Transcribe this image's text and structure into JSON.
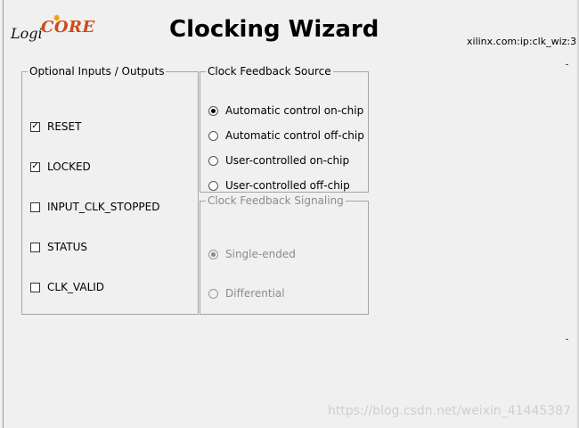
{
  "header": {
    "logo_logi": "Logi",
    "logo_core": "CORE",
    "title": "Clocking Wizard",
    "vlnv": "xilinx.com:ip:clk_wiz:3"
  },
  "optional_io": {
    "legend": "Optional Inputs / Outputs",
    "items": [
      {
        "label": "RESET",
        "checked": true
      },
      {
        "label": "LOCKED",
        "checked": true
      },
      {
        "label": "INPUT_CLK_STOPPED",
        "checked": false
      },
      {
        "label": "STATUS",
        "checked": false
      },
      {
        "label": "CLK_VALID",
        "checked": false
      }
    ]
  },
  "feedback_source": {
    "legend": "Clock Feedback Source",
    "options": [
      {
        "label": "Automatic control on-chip",
        "selected": true
      },
      {
        "label": "Automatic control off-chip",
        "selected": false
      },
      {
        "label": "User-controlled on-chip",
        "selected": false
      },
      {
        "label": "User-controlled off-chip",
        "selected": false
      }
    ]
  },
  "feedback_signaling": {
    "legend": "Clock Feedback Signaling",
    "enabled": false,
    "options": [
      {
        "label": "Single-ended",
        "selected": true
      },
      {
        "label": "Differential",
        "selected": false
      }
    ]
  },
  "watermark": "https://blog.csdn.net/weixin_41445387"
}
